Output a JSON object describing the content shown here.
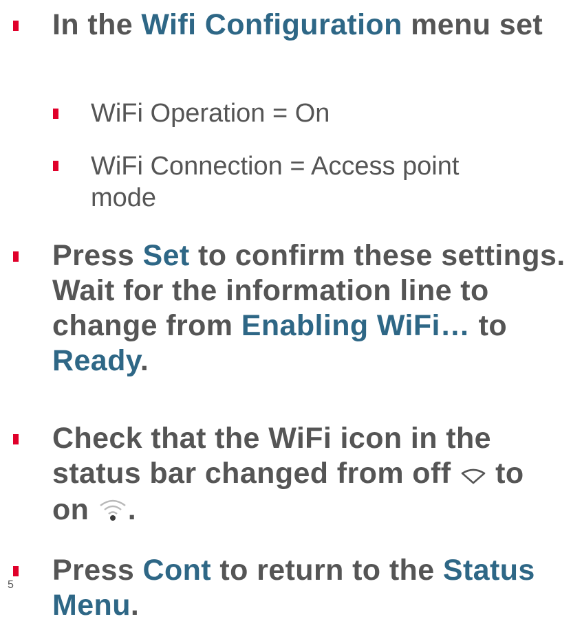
{
  "colors": {
    "text": "#555555",
    "highlight": "#2e6786",
    "bullet": "#e0002a"
  },
  "b1": {
    "t1": "In the ",
    "h1": "Wifi Configuration",
    "t2": " menu set",
    "subs": [
      "WiFi Operation = On",
      "WiFi Connection = Access point mode"
    ]
  },
  "b2": {
    "t1": "Press ",
    "h1": "Set",
    "t2": " to confirm these settings. Wait for the information line to change from ",
    "h2": "Enabling WiFi…",
    "t3": " to ",
    "h3": "Ready",
    "t4": "."
  },
  "b3": {
    "t1": "Check that the WiFi icon in the status bar changed from off ",
    "t2": " to on ",
    "t3": ".",
    "icon_off": "wifi-off-icon",
    "icon_on": "wifi-on-icon"
  },
  "b4": {
    "t1": "Press ",
    "h1": "Cont",
    "t2": " to return to the ",
    "h2": "Status Menu",
    "t3": "."
  },
  "page_number": "5"
}
